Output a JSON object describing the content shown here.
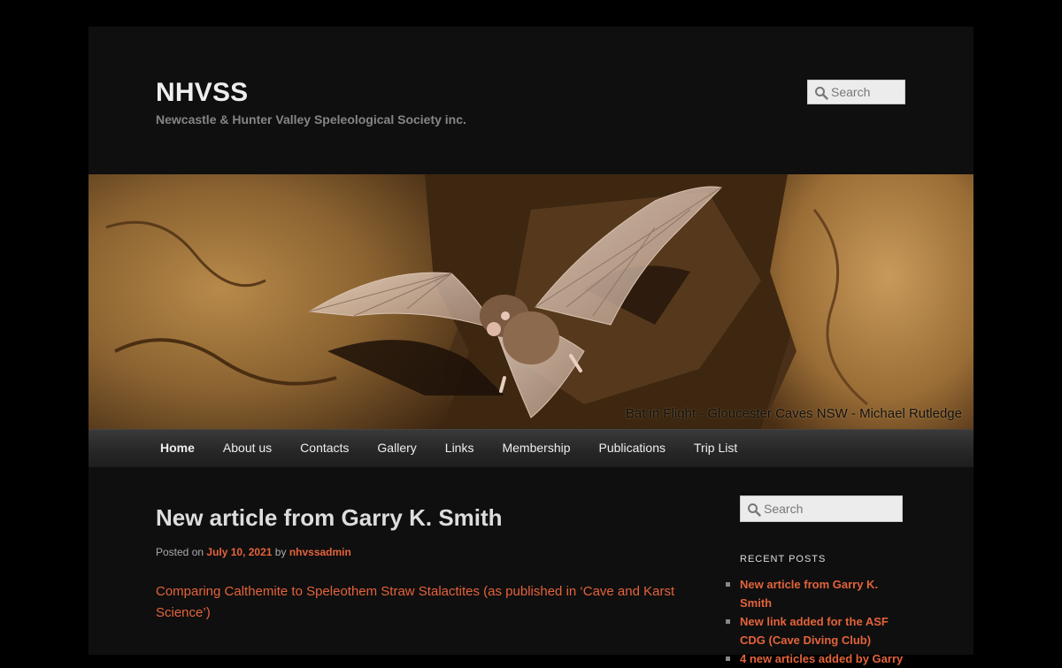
{
  "site": {
    "title": "NHVSS",
    "description": "Newcastle & Hunter Valley Speleological Society inc."
  },
  "header_search": {
    "placeholder": "Search"
  },
  "banner": {
    "caption": "Bat in Flight - Gloucester Caves NSW - Michael Rutledge"
  },
  "nav": {
    "items": [
      {
        "label": "Home"
      },
      {
        "label": "About us"
      },
      {
        "label": "Contacts"
      },
      {
        "label": "Gallery"
      },
      {
        "label": "Links"
      },
      {
        "label": "Membership"
      },
      {
        "label": "Publications"
      },
      {
        "label": "Trip List"
      }
    ]
  },
  "post": {
    "title": "New article from Garry K. Smith",
    "posted_on": "Posted on",
    "date": "July 10, 2021",
    "by": "by",
    "author": "nhvssadmin",
    "link_text": "Comparing Calthemite to Speleothem Straw Stalactites (as published in ‘Cave and Karst Science’)"
  },
  "sidebar": {
    "search_placeholder": "Search",
    "recent_title": "RECENT POSTS",
    "recent_posts": [
      {
        "label": "New article from Garry K. Smith"
      },
      {
        "label": "New link added for the ASF CDG (Cave Diving Club)"
      },
      {
        "label": "4 new articles added by Garry"
      }
    ]
  },
  "colors": {
    "link": "#e4633b",
    "page_bg": "#0f0f0f",
    "outer_bg": "#000000"
  }
}
